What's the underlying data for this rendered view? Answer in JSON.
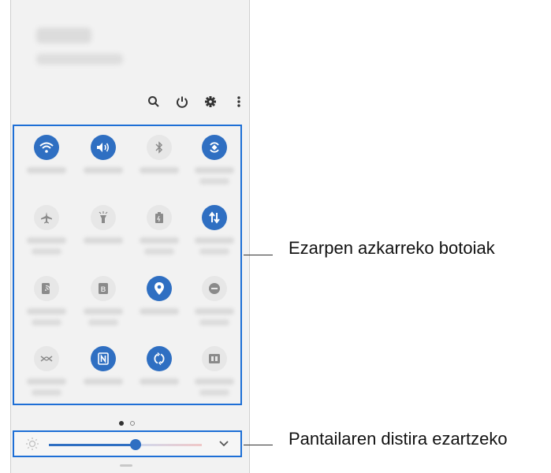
{
  "quick_panel": {
    "top_icons": [
      "search-icon",
      "power-icon",
      "settings-icon",
      "more-options-icon"
    ],
    "tiles": [
      {
        "icon": "wifi-icon",
        "state": "on"
      },
      {
        "icon": "sound-icon",
        "state": "on"
      },
      {
        "icon": "bluetooth-icon",
        "state": "off"
      },
      {
        "icon": "auto-rotate-icon",
        "state": "on"
      },
      {
        "icon": "airplane-mode-icon",
        "state": "off"
      },
      {
        "icon": "flashlight-icon",
        "state": "off"
      },
      {
        "icon": "power-saving-icon",
        "state": "off"
      },
      {
        "icon": "mobile-data-icon",
        "state": "on"
      },
      {
        "icon": "mobile-hotspot-icon",
        "state": "off"
      },
      {
        "icon": "blue-light-filter-icon",
        "state": "off"
      },
      {
        "icon": "location-icon",
        "state": "on"
      },
      {
        "icon": "do-not-disturb-icon",
        "state": "off"
      },
      {
        "icon": "nearby-share-icon",
        "state": "off"
      },
      {
        "icon": "nfc-icon",
        "state": "on"
      },
      {
        "icon": "sync-icon",
        "state": "on"
      },
      {
        "icon": "dual-audio-icon",
        "state": "off"
      }
    ],
    "page_indicator": {
      "current": 1,
      "total": 2
    },
    "brightness": {
      "level": 0.45,
      "accent": "#2f6fc2"
    }
  },
  "callouts": {
    "quick_buttons": "Ezarpen azkarreko botoiak",
    "brightness": "Pantailaren distira ezartzeko"
  },
  "colors": {
    "highlight": "#1e6fd6",
    "toggle_on": "#2f6fc2",
    "toggle_off": "#e7e7e7"
  }
}
